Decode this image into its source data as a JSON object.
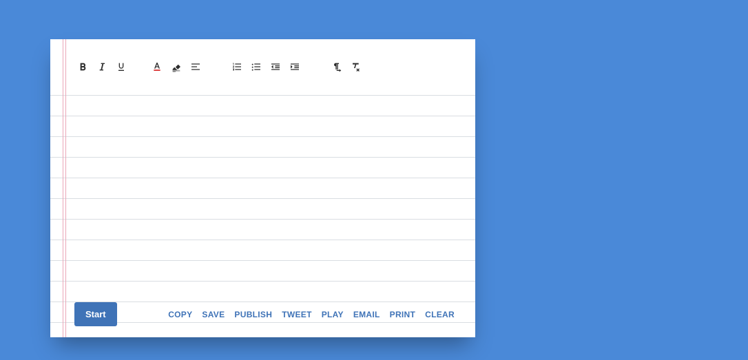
{
  "toolbar": {
    "icons": {
      "bold": "bold-icon",
      "italic": "italic-icon",
      "underline": "underline-icon",
      "text_color": "text-color-icon",
      "highlight": "highlight-icon",
      "align": "align-icon",
      "ordered_list": "ordered-list-icon",
      "unordered_list": "unordered-list-icon",
      "outdent": "outdent-icon",
      "indent": "indent-icon",
      "ltr": "ltr-icon",
      "clear_format": "clear-format-icon"
    }
  },
  "editor": {
    "content": ""
  },
  "footer": {
    "start_label": "Start",
    "actions": {
      "copy": "COPY",
      "save": "SAVE",
      "publish": "PUBLISH",
      "tweet": "TWEET",
      "play": "PLAY",
      "email": "EMAIL",
      "print": "PRINT",
      "clear": "CLEAR"
    }
  },
  "colors": {
    "page_bg": "#4a89d8",
    "accent": "#3f73b7",
    "rule": "#d9dde2",
    "margin_line": "#eaa6b8"
  }
}
